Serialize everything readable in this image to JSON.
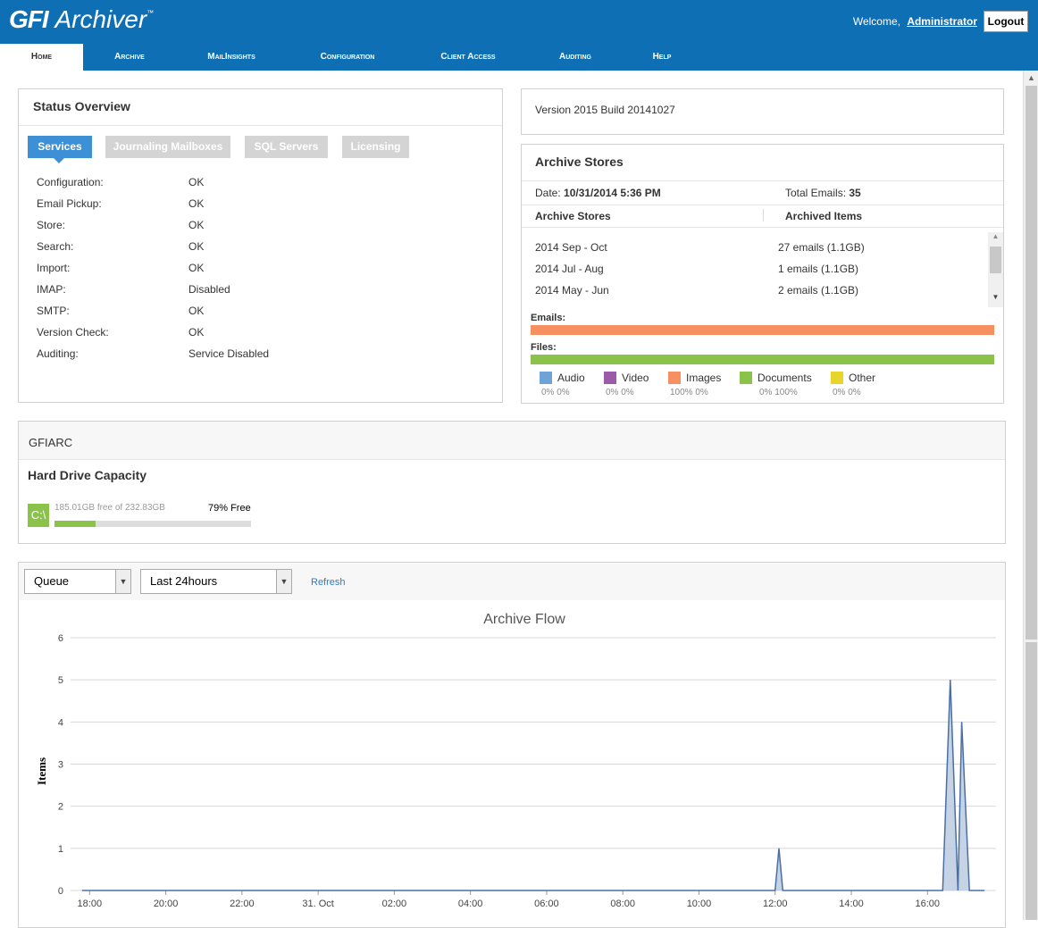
{
  "app": {
    "logo_brand": "GFI",
    "logo_product": "Archiver",
    "logo_tm": "™"
  },
  "header": {
    "welcome": "Welcome,",
    "user": "Administrator",
    "logout": "Logout"
  },
  "nav": [
    {
      "label": "Home"
    },
    {
      "label": "Archive"
    },
    {
      "label": "MailInsights"
    },
    {
      "label": "Configuration"
    },
    {
      "label": "Client Access"
    },
    {
      "label": "Auditing"
    },
    {
      "label": "Help"
    }
  ],
  "status": {
    "title": "Status Overview",
    "tabs": [
      {
        "label": "Services"
      },
      {
        "label": "Journaling Mailboxes"
      },
      {
        "label": "SQL Servers"
      },
      {
        "label": "Licensing"
      }
    ],
    "services": [
      {
        "name": "Configuration:",
        "value": "OK"
      },
      {
        "name": "Email Pickup:",
        "value": "OK"
      },
      {
        "name": "Store:",
        "value": "OK"
      },
      {
        "name": "Search:",
        "value": "OK"
      },
      {
        "name": "Import:",
        "value": "OK"
      },
      {
        "name": "IMAP:",
        "value": "Disabled"
      },
      {
        "name": "SMTP:",
        "value": "OK"
      },
      {
        "name": "Version Check:",
        "value": "OK"
      },
      {
        "name": "Auditing:",
        "value": "Service Disabled"
      }
    ]
  },
  "version": "Version 2015 Build 20141027",
  "stores": {
    "title": "Archive Stores",
    "date_label": "Date:",
    "date_value": "10/31/2014 5:36 PM",
    "total_label": "Total Emails:",
    "total_value": "35",
    "col_store": "Archive Stores",
    "col_items": "Archived Items",
    "rows": [
      {
        "store": "2014 Sep - Oct",
        "items": "27 emails (1.1GB)"
      },
      {
        "store": "2014 Jul - Aug",
        "items": "1 emails (1.1GB)"
      },
      {
        "store": "2014 May - Jun",
        "items": "2 emails (1.1GB)"
      }
    ],
    "emails_label": "Emails:",
    "files_label": "Files:",
    "colors": {
      "emails": "#f79060",
      "files": "#8bc34a"
    },
    "legend": [
      {
        "label": "Audio",
        "color": "#6fa3d8",
        "pct": "0%  0%"
      },
      {
        "label": "Video",
        "color": "#9c5ba8",
        "pct": "0%  0%"
      },
      {
        "label": "Images",
        "color": "#f79060",
        "pct": "100%  0%"
      },
      {
        "label": "Documents",
        "color": "#8bc34a",
        "pct": "0%  100%"
      },
      {
        "label": "Other",
        "color": "#e8d52c",
        "pct": "0%  0%"
      }
    ]
  },
  "server": {
    "name": "GFIARC",
    "hd_title": "Hard Drive Capacity",
    "drive": "C:\\",
    "free_text": "185.01GB free of 232.83GB",
    "free_pct_text": "79% Free",
    "used_fraction": 0.21
  },
  "flow": {
    "select_type": "Queue",
    "select_range": "Last 24hours",
    "refresh": "Refresh"
  },
  "chart_data": {
    "type": "area",
    "title": "Archive Flow",
    "ylabel": "Items",
    "xlabel": "",
    "ylim": [
      0,
      6
    ],
    "yticks": [
      "0",
      "1",
      "2",
      "3",
      "4",
      "5",
      "6"
    ],
    "xticks": [
      "18:00",
      "20:00",
      "22:00",
      "31. Oct",
      "02:00",
      "04:00",
      "06:00",
      "08:00",
      "10:00",
      "12:00",
      "14:00",
      "16:00"
    ],
    "xtick_hours": [
      0,
      2,
      4,
      6,
      8,
      10,
      12,
      14,
      16,
      18,
      20,
      22
    ],
    "series": [
      {
        "color": "#4a6fa5",
        "points": [
          [
            -0.2,
            0
          ],
          [
            18.0,
            0
          ],
          [
            18.1,
            1
          ],
          [
            18.2,
            0
          ],
          [
            22.4,
            0
          ],
          [
            22.6,
            5
          ],
          [
            22.8,
            0
          ],
          [
            22.9,
            4
          ],
          [
            23.1,
            0
          ],
          [
            23.5,
            0
          ]
        ]
      }
    ]
  }
}
